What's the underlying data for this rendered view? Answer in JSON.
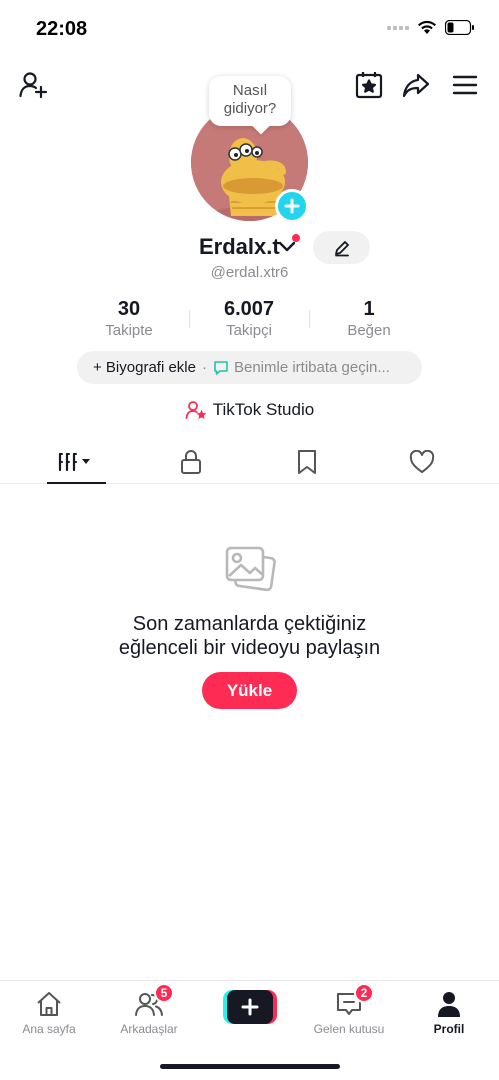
{
  "status_bar": {
    "time": "22:08"
  },
  "profile": {
    "bubble_line1": "Nasıl",
    "bubble_line2": "gidiyor?",
    "username": "Erdalx.t",
    "handle": "@erdal.xtr6"
  },
  "stats": [
    {
      "value": "30",
      "label": "Takipte"
    },
    {
      "value": "6.007",
      "label": "Takipçi"
    },
    {
      "value": "1",
      "label": "Beğen"
    }
  ],
  "bio": {
    "add_label": "+ Biyografi ekle",
    "separator": "·",
    "contact_label": "Benimle irtibata geçin..."
  },
  "studio_label": "TikTok Studio",
  "empty_state": {
    "line1": "Son zamanlarda çektiğiniz",
    "line2": "eğlenceli bir videoyu paylaşın",
    "button": "Yükle"
  },
  "bottom_nav": {
    "home": "Ana sayfa",
    "friends": "Arkadaşlar",
    "friends_badge": "5",
    "inbox": "Gelen kutusu",
    "inbox_badge": "2",
    "profile": "Profil"
  },
  "colors": {
    "accent": "#fe2c55",
    "cyan": "#20d5ec",
    "text": "#161823",
    "muted": "#8a8b91"
  }
}
